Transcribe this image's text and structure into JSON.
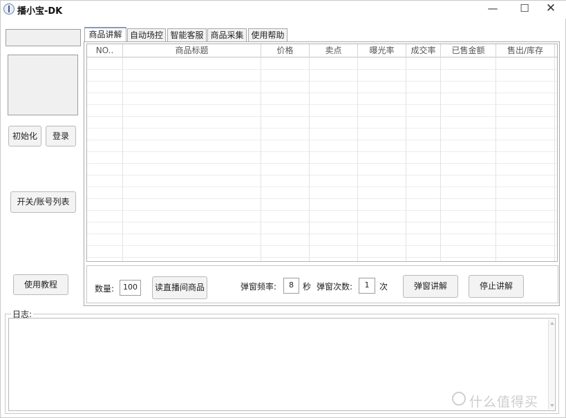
{
  "window": {
    "title": "播小宝-DK",
    "minimize": "—",
    "maximize": "☐",
    "close": "✕"
  },
  "left": {
    "init_label": "初始化",
    "login_label": "登录",
    "switch_label": "开关/账号列表",
    "tutorial_label": "使用教程"
  },
  "tabs": [
    {
      "label": "商品讲解"
    },
    {
      "label": "自动场控"
    },
    {
      "label": "智能客服"
    },
    {
      "label": "商品采集"
    },
    {
      "label": "使用帮助"
    }
  ],
  "grid": {
    "columns": [
      "NO..",
      "商品标题",
      "价格",
      "卖点",
      "曝光率",
      "成交率",
      "已售金额",
      "售出/库存"
    ]
  },
  "controls": {
    "quantity_label": "数量:",
    "quantity_value": "100",
    "read_button": "读直播间商品",
    "freq_label": "弹窗频率:",
    "freq_value": "8",
    "freq_unit": "秒",
    "count_label": "弹窗次数:",
    "count_value": "1",
    "count_unit": "次",
    "popup_button": "弹窗讲解",
    "stop_button": "停止讲解"
  },
  "log": {
    "label": "日志:"
  },
  "watermark": {
    "text": "什么值得买",
    "icon": "zhi-logo-icon"
  }
}
